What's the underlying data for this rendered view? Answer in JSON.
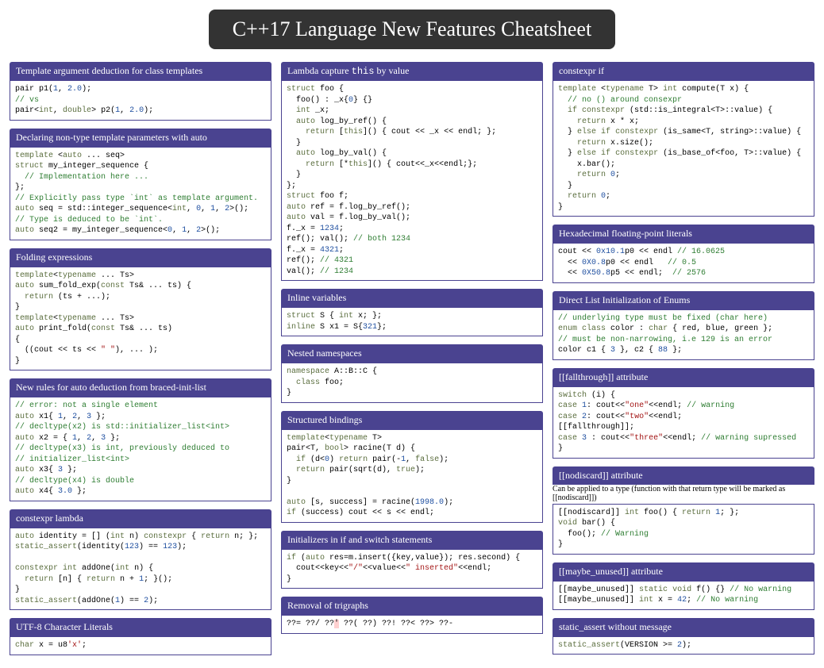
{
  "page_title": "C++17 Language New Features Cheatsheet",
  "col1": {
    "s1": {
      "title": "Template argument deduction for class templates"
    },
    "s2": {
      "title": "Declaring non-type template parameters with auto"
    },
    "s3": {
      "title": "Folding expressions"
    },
    "s4": {
      "title": "New rules for auto deduction from braced-init-list"
    },
    "s5": {
      "title": "constexpr lambda"
    },
    "s6": {
      "title": "UTF-8 Character Literals"
    }
  },
  "col2": {
    "s1": {
      "title_pre": "Lambda capture ",
      "title_tt": "this",
      "title_post": " by value"
    },
    "s2": {
      "title": "Inline variables"
    },
    "s3": {
      "title": "Nested namespaces"
    },
    "s4": {
      "title": "Structured bindings"
    },
    "s5": {
      "title": "Initializers in if and switch statements"
    },
    "s6": {
      "title": "Removal of trigraphs"
    }
  },
  "col3": {
    "s1": {
      "title": "constexpr if"
    },
    "s2": {
      "title": "Hexadecimal floating-point literals"
    },
    "s3": {
      "title": "Direct List Initialization of Enums"
    },
    "s4": {
      "title": "[[fallthrough]] attribute"
    },
    "s5": {
      "title": "[[nodiscard]] attribute",
      "note": "Can be applied to a type (function with that return type will be marked as [[nodiscard]])"
    },
    "s6": {
      "title": "[[maybe_unused]] attribute"
    },
    "s7": {
      "title": "static_assert without message"
    }
  },
  "code": {
    "c1_1": {
      "l1a": "pair p1(",
      "l1b": "1",
      "l1c": ", ",
      "l1d": "2.0",
      "l1e": ");",
      "l2": "// vs",
      "l3a": "pair<",
      "l3b": "int",
      "l3c": ", ",
      "l3d": "double",
      "l3e": "> p2(",
      "l3f": "1",
      "l3g": ", ",
      "l3h": "2.0",
      "l3i": ");"
    },
    "c1_2": {
      "l1a": "template",
      "l1b": " <",
      "l1c": "auto",
      "l1d": " ... seq>",
      "l2a": "struct",
      "l2b": " my_integer_sequence {",
      "l3": "  // Implementation here ...",
      "l4": "};",
      "l5": "// Explicitly pass type `int` as template argument.",
      "l6a": "auto",
      "l6b": " seq = std::integer_sequence<",
      "l6c": "int",
      "l6d": ", ",
      "l6e": "0",
      "l6f": ", ",
      "l6g": "1",
      "l6h": ", ",
      "l6i": "2",
      "l6j": ">();",
      "l7": "// Type is deduced to be `int`.",
      "l8a": "auto",
      "l8b": " seq2 = my_integer_sequence<",
      "l8c": "0",
      "l8d": ", ",
      "l8e": "1",
      "l8f": ", ",
      "l8g": "2",
      "l8h": ">();"
    },
    "c1_3": {
      "l1a": "template",
      "l1b": "<",
      "l1c": "typename",
      "l1d": " ... Ts>",
      "l2a": "auto",
      "l2b": " sum_fold_exp(",
      "l2c": "const",
      "l2d": " Ts& ... ts) {",
      "l3a": "  return",
      "l3b": " (ts + ...);",
      "l4": "}",
      "l5a": "template",
      "l5b": "<",
      "l5c": "typename",
      "l5d": " ... Ts>",
      "l6a": "auto",
      "l6b": " print_fold(",
      "l6c": "const",
      "l6d": " Ts& ... ts)",
      "l7": "{",
      "l8a": "  ((cout << ts << ",
      "l8b": "\" \"",
      "l8c": "), ... );",
      "l9": "}"
    },
    "c1_4": {
      "l1": "// error: not a single element",
      "l2a": "auto",
      "l2b": " x1{ ",
      "l2c": "1",
      "l2d": ", ",
      "l2e": "2",
      "l2f": ", ",
      "l2g": "3",
      "l2h": " };",
      "l3": "// decltype(x2) is std::initializer_list<int>",
      "l4a": "auto",
      "l4b": " x2 = { ",
      "l4c": "1",
      "l4d": ", ",
      "l4e": "2",
      "l4f": ", ",
      "l4g": "3",
      "l4h": " };",
      "l5": "// decltype(x3) is int, previously deduced to",
      "l6": "// initializer_list<int>",
      "l7a": "auto",
      "l7b": " x3{ ",
      "l7c": "3",
      "l7d": " };",
      "l8": "// decltype(x4) is double",
      "l9a": "auto",
      "l9b": " x4{ ",
      "l9c": "3.0",
      "l9d": " };"
    },
    "c1_5": {
      "l1a": "auto",
      "l1b": " identity = [] (",
      "l1c": "int",
      "l1d": " n) ",
      "l1e": "constexpr",
      "l1f": " { ",
      "l1g": "return",
      "l1h": " n; };",
      "l2a": "static_assert",
      "l2b": "(identity(",
      "l2c": "123",
      "l2d": ") == ",
      "l2e": "123",
      "l2f": ");",
      "l3": "",
      "l4a": "constexpr",
      "l4b": " ",
      "l4c": "int",
      "l4d": " addOne(",
      "l4e": "int",
      "l4f": " n) {",
      "l5a": "  return",
      "l5b": " [n] { ",
      "l5c": "return",
      "l5d": " n + ",
      "l5e": "1",
      "l5f": "; }();",
      "l6": "}",
      "l7a": "static_assert",
      "l7b": "(addOne(",
      "l7c": "1",
      "l7d": ") == ",
      "l7e": "2",
      "l7f": ");"
    },
    "c1_6": {
      "l1a": "char",
      "l1b": " x = u8",
      "l1c": "'x'",
      "l1d": ";"
    },
    "c2_1": {
      "l1a": "struct",
      "l1b": " foo {",
      "l2a": "  foo() : _x{",
      "l2b": "0",
      "l2c": "} {}",
      "l3a": "  int",
      "l3b": " _x;",
      "l4a": "  auto",
      "l4b": " log_by_ref() {",
      "l5a": "    return",
      "l5b": " [",
      "l5c": "this",
      "l5d": "]() { cout << _x << endl; };",
      "l6": "  }",
      "l7a": "  auto",
      "l7b": " log_by_val() {",
      "l8a": "    return",
      "l8b": " [*",
      "l8c": "this",
      "l8d": "]() { cout<<_x<<endl;};",
      "l9": "  }",
      "l10": "};",
      "l11a": "struct",
      "l11b": " foo f;",
      "l12a": "auto",
      "l12b": " ref = f.log_by_ref();",
      "l13a": "auto",
      "l13b": " val = f.log_by_val();",
      "l14a": "f._x = ",
      "l14b": "1234",
      "l14c": ";",
      "l15a": "ref(); val(); ",
      "l15b": "// both 1234",
      "l16a": "f._x = ",
      "l16b": "4321",
      "l16c": ";",
      "l17a": "ref(); ",
      "l17b": "// 4321",
      "l18a": "val(); ",
      "l18b": "// 1234"
    },
    "c2_2": {
      "l1a": "struct",
      "l1b": " S { ",
      "l1c": "int",
      "l1d": " x; };",
      "l2a": "inline",
      "l2b": " S x1 = S{",
      "l2c": "321",
      "l2d": "};"
    },
    "c2_3": {
      "l1a": "namespace",
      "l1b": " A::B::C {",
      "l2a": "  class",
      "l2b": " foo;",
      "l3": "}"
    },
    "c2_4": {
      "l1a": "template",
      "l1b": "<",
      "l1c": "typename",
      "l1d": " T>",
      "l2a": "pair<T, ",
      "l2b": "bool",
      "l2c": "> racine(T d) {",
      "l3a": "  if",
      "l3b": " (d<",
      "l3c": "0",
      "l3d": ") ",
      "l3e": "return",
      "l3f": " pair(-",
      "l3g": "1",
      "l3h": ", ",
      "l3i": "false",
      "l3j": ");",
      "l4a": "  return",
      "l4b": " pair(sqrt(d), ",
      "l4c": "true",
      "l4d": ");",
      "l5": "}",
      "l6": "",
      "l7a": "auto",
      "l7b": " [s, success] = racine(",
      "l7c": "1998.0",
      "l7d": ");",
      "l8a": "if",
      "l8b": " (success) cout << s << endl;"
    },
    "c2_5": {
      "l1a": "if",
      "l1b": " (",
      "l1c": "auto",
      "l1d": " res=m.insert({key,value}); res.second) {",
      "l2a": "  cout<<key<<",
      "l2b": "\"/\"",
      "l2c": "<<value<<",
      "l2d": "\" inserted\"",
      "l2e": "<<endl;",
      "l3": "}"
    },
    "c2_6": {
      "l1a": "??= ??/ ??",
      "l1hl": "'",
      "l1b": " ??( ??) ??! ??< ??> ??-"
    },
    "c3_1": {
      "l1a": "template",
      "l1b": " <",
      "l1c": "typename",
      "l1d": " T> ",
      "l1e": "int",
      "l1f": " compute(T x) {",
      "l2": "  // no () around consexpr",
      "l3a": "  if",
      "l3b": " ",
      "l3c": "constexpr",
      "l3d": " (std::is_integral<T>::value) {",
      "l4a": "    return",
      "l4b": " x * x;",
      "l5a": "  } ",
      "l5b": "else",
      "l5c": " ",
      "l5d": "if",
      "l5e": " ",
      "l5f": "constexpr",
      "l5g": " (is_same<T, string>::value) {",
      "l6a": "    return",
      "l6b": " x.size();",
      "l7a": "  } ",
      "l7b": "else",
      "l7c": " ",
      "l7d": "if",
      "l7e": " ",
      "l7f": "constexpr",
      "l7g": " (is_base_of<foo, T>::value) {",
      "l8": "    x.bar();",
      "l9a": "    return",
      "l9b": " ",
      "l9c": "0",
      "l9d": ";",
      "l10": "  }",
      "l11a": "  return",
      "l11b": " ",
      "l11c": "0",
      "l11d": ";",
      "l12": "}"
    },
    "c3_2": {
      "l1a": "cout << ",
      "l1b": "0x10.1",
      "l1c": "p0 << endl ",
      "l1d": "// 16.0625",
      "l2a": "  << ",
      "l2b": "0X0.8",
      "l2c": "p0 << endl   ",
      "l2d": "// 0.5",
      "l3a": "  << ",
      "l3b": "0X50.8",
      "l3c": "p5 << endl;  ",
      "l3d": "// 2576"
    },
    "c3_3": {
      "l1": "// underlying type must be fixed (char here)",
      "l2a": "enum",
      "l2b": " ",
      "l2c": "class",
      "l2d": " color : ",
      "l2e": "char",
      "l2f": " { red, blue, green };",
      "l3": "// must be non-narrowing, i.e 129 is an error",
      "l4a": "color c1 { ",
      "l4b": "3",
      "l4c": " }, c2 { ",
      "l4d": "88",
      "l4e": " };"
    },
    "c3_4": {
      "l1a": "switch",
      "l1b": " (i) {",
      "l2a": "case",
      "l2b": " ",
      "l2c": "1",
      "l2d": ": cout<<",
      "l2e": "\"one\"",
      "l2f": "<<endl; ",
      "l2g": "// warning",
      "l3a": "case",
      "l3b": " ",
      "l3c": "2",
      "l3d": ": cout<<",
      "l3e": "\"two\"",
      "l3f": "<<endl;",
      "l4": "[[fallthrough]];",
      "l5a": "case",
      "l5b": " ",
      "l5c": "3",
      "l5d": " : cout<<",
      "l5e": "\"three\"",
      "l5f": "<<endl; ",
      "l5g": "// warning supressed",
      "l6": "}"
    },
    "c3_5": {
      "l1a": "[[nodiscard]] ",
      "l1b": "int",
      "l1c": " foo() { ",
      "l1d": "return",
      "l1e": " ",
      "l1f": "1",
      "l1g": "; };",
      "l2a": "void",
      "l2b": " bar() {",
      "l3a": "  foo(); ",
      "l3b": "// Warning",
      "l4": "}"
    },
    "c3_6": {
      "l1a": "[[maybe_unused]] ",
      "l1b": "static",
      "l1c": " ",
      "l1d": "void",
      "l1e": " f() {} ",
      "l1f": "// No warning",
      "l2a": "[[maybe_unused]] ",
      "l2b": "int",
      "l2c": " x = ",
      "l2d": "42",
      "l2e": "; ",
      "l2f": "// No warning"
    },
    "c3_7": {
      "l1a": "static_assert",
      "l1b": "(VERSION >= ",
      "l1c": "2",
      "l1d": ");"
    }
  }
}
